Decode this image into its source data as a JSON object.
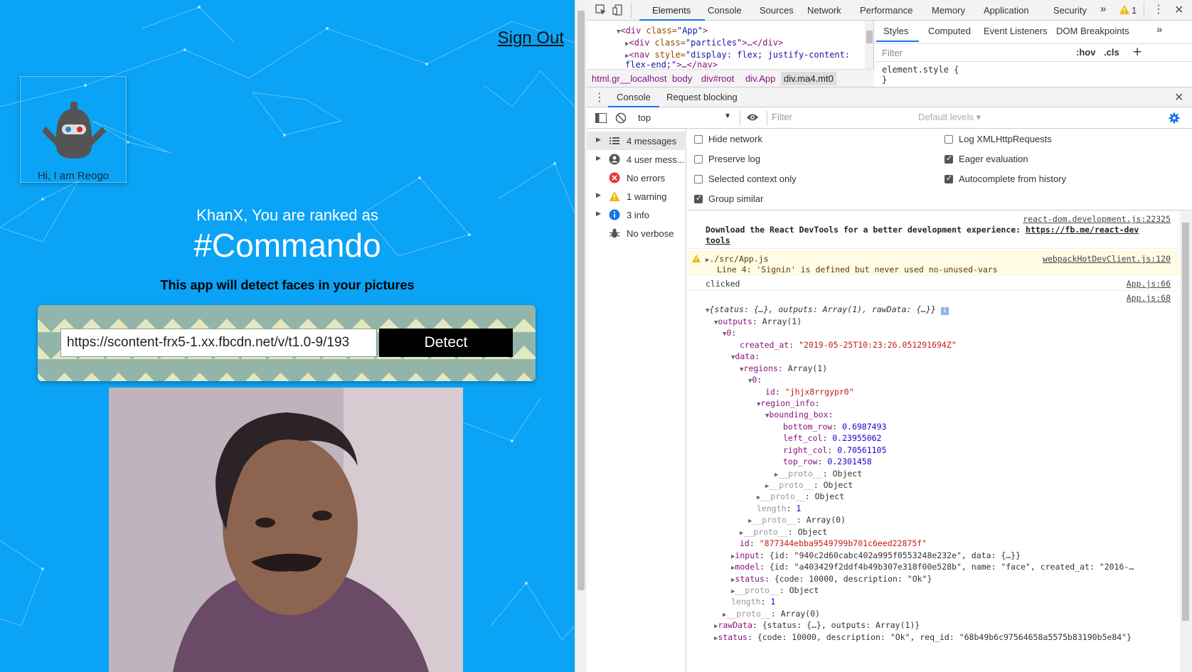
{
  "app": {
    "sign_out": "Sign Out",
    "logo_caption": "Hi, I am Reogo",
    "rank_line": "KhanX, You are ranked as",
    "rank_title": "#Commando",
    "subtitle": "This app will detect faces in your pictures",
    "url_value": "https://scontent-frx5-1.xx.fbcdn.net/v/t1.0-9/193",
    "detect_label": "Detect",
    "colors": {
      "background": "#0aa3f5",
      "button": "#000000"
    }
  },
  "devtools": {
    "tabs": [
      "Elements",
      "Console",
      "Sources",
      "Network",
      "Performance",
      "Memory",
      "Application",
      "Security"
    ],
    "more_tabs": "»",
    "warning_count": "1",
    "elements_lines": [
      {
        "tag_open": "<div ",
        "attr": "class=",
        "val": "\"App\"",
        "tag_close": ">"
      },
      {
        "tag_open": "<div ",
        "attr": "class=",
        "val": "\"particles\"",
        "tag_close": ">…</div>"
      },
      {
        "tag_open": "<nav ",
        "attr": "style=",
        "val": "\"display: flex; justify-content:",
        "tag_close": ""
      },
      {
        "tag_open": "",
        "attr": "",
        "val": "flex-end;\"",
        "tag_close": ">…</nav>"
      }
    ],
    "breadcrumbs": [
      "html.gr__localhost",
      "body",
      "div#root",
      "div.App",
      "div.ma4.mt0"
    ],
    "styles_tabs": [
      "Styles",
      "Computed",
      "Event Listeners",
      "DOM Breakpoints",
      "»"
    ],
    "styles_filter_placeholder": "Filter",
    "styles_hov": ":hov",
    "styles_cls": ".cls",
    "element_style": "element.style {",
    "element_style_close": "}",
    "drawer_tabs": [
      "Console",
      "Request blocking"
    ],
    "context": "top",
    "console_filter_placeholder": "Filter",
    "default_levels": "Default levels ▾",
    "sidebar": [
      {
        "label": "4 messages",
        "icon": "list-icon"
      },
      {
        "label": "4 user mess...",
        "icon": "user-icon"
      },
      {
        "label": "No errors",
        "icon": "error-icon"
      },
      {
        "label": "1 warning",
        "icon": "warning-icon"
      },
      {
        "label": "3 info",
        "icon": "info-icon"
      },
      {
        "label": "No verbose",
        "icon": "bug-icon"
      }
    ],
    "settings": [
      {
        "label": "Hide network",
        "checked": false
      },
      {
        "label": "Preserve log",
        "checked": false
      },
      {
        "label": "Selected context only",
        "checked": false
      },
      {
        "label": "Group similar",
        "checked": true
      },
      {
        "label": "Log XMLHttpRequests",
        "checked": false
      },
      {
        "label": "Eager evaluation",
        "checked": true
      },
      {
        "label": "Autocomplete from history",
        "checked": true
      }
    ],
    "log": {
      "msg1_src": "react-dom.development.js:22325",
      "msg1_text": "Download the React DevTools for a better development experience: ",
      "msg1_link": "https://fb.me/react-dev",
      "msg1_link2": "tools",
      "warn_path": "./src/App.js",
      "warn_src": "webpackHotDevClient.js:120",
      "warn_detail": "Line 4:  'Signin' is defined but never used  no-unused-vars",
      "clicked": "clicked",
      "clicked_src": "App.js:66",
      "obj_src": "App.js:68",
      "obj_summary": "{status: {…}, outputs: Array(1), rawData: {…}}",
      "outputs": "Array(1)",
      "created_at": "\"2019-05-25T10:23:26.051291694Z\"",
      "regions": "Array(1)",
      "id_region": "\"jhjx8rrgypr0\"",
      "bottom_row": "0.6987493",
      "left_col": "0.23955062",
      "right_col": "0.70561105",
      "top_row": "0.2301458",
      "proto_object": "Object",
      "length_1": "1",
      "proto_array0": "Array(0)",
      "output_id": "\"877344ebba9549799b701c6eed22875f\"",
      "input": "{id: \"940c2d60cabc402a995f0553248e232e\", data: {…}}",
      "model": "{id: \"a403429f2ddf4b49b307e318f00e528b\", name: \"face\", created_at: \"2016-…",
      "status_inner": "{code: 10000, description: \"Ok\"}",
      "rawData": "{status: {…}, outputs: Array(1)}",
      "status_outer": "{code: 10000, description: \"Ok\", req_id: \"68b49b6c97564658a5575b83190b5e84\"}"
    }
  }
}
